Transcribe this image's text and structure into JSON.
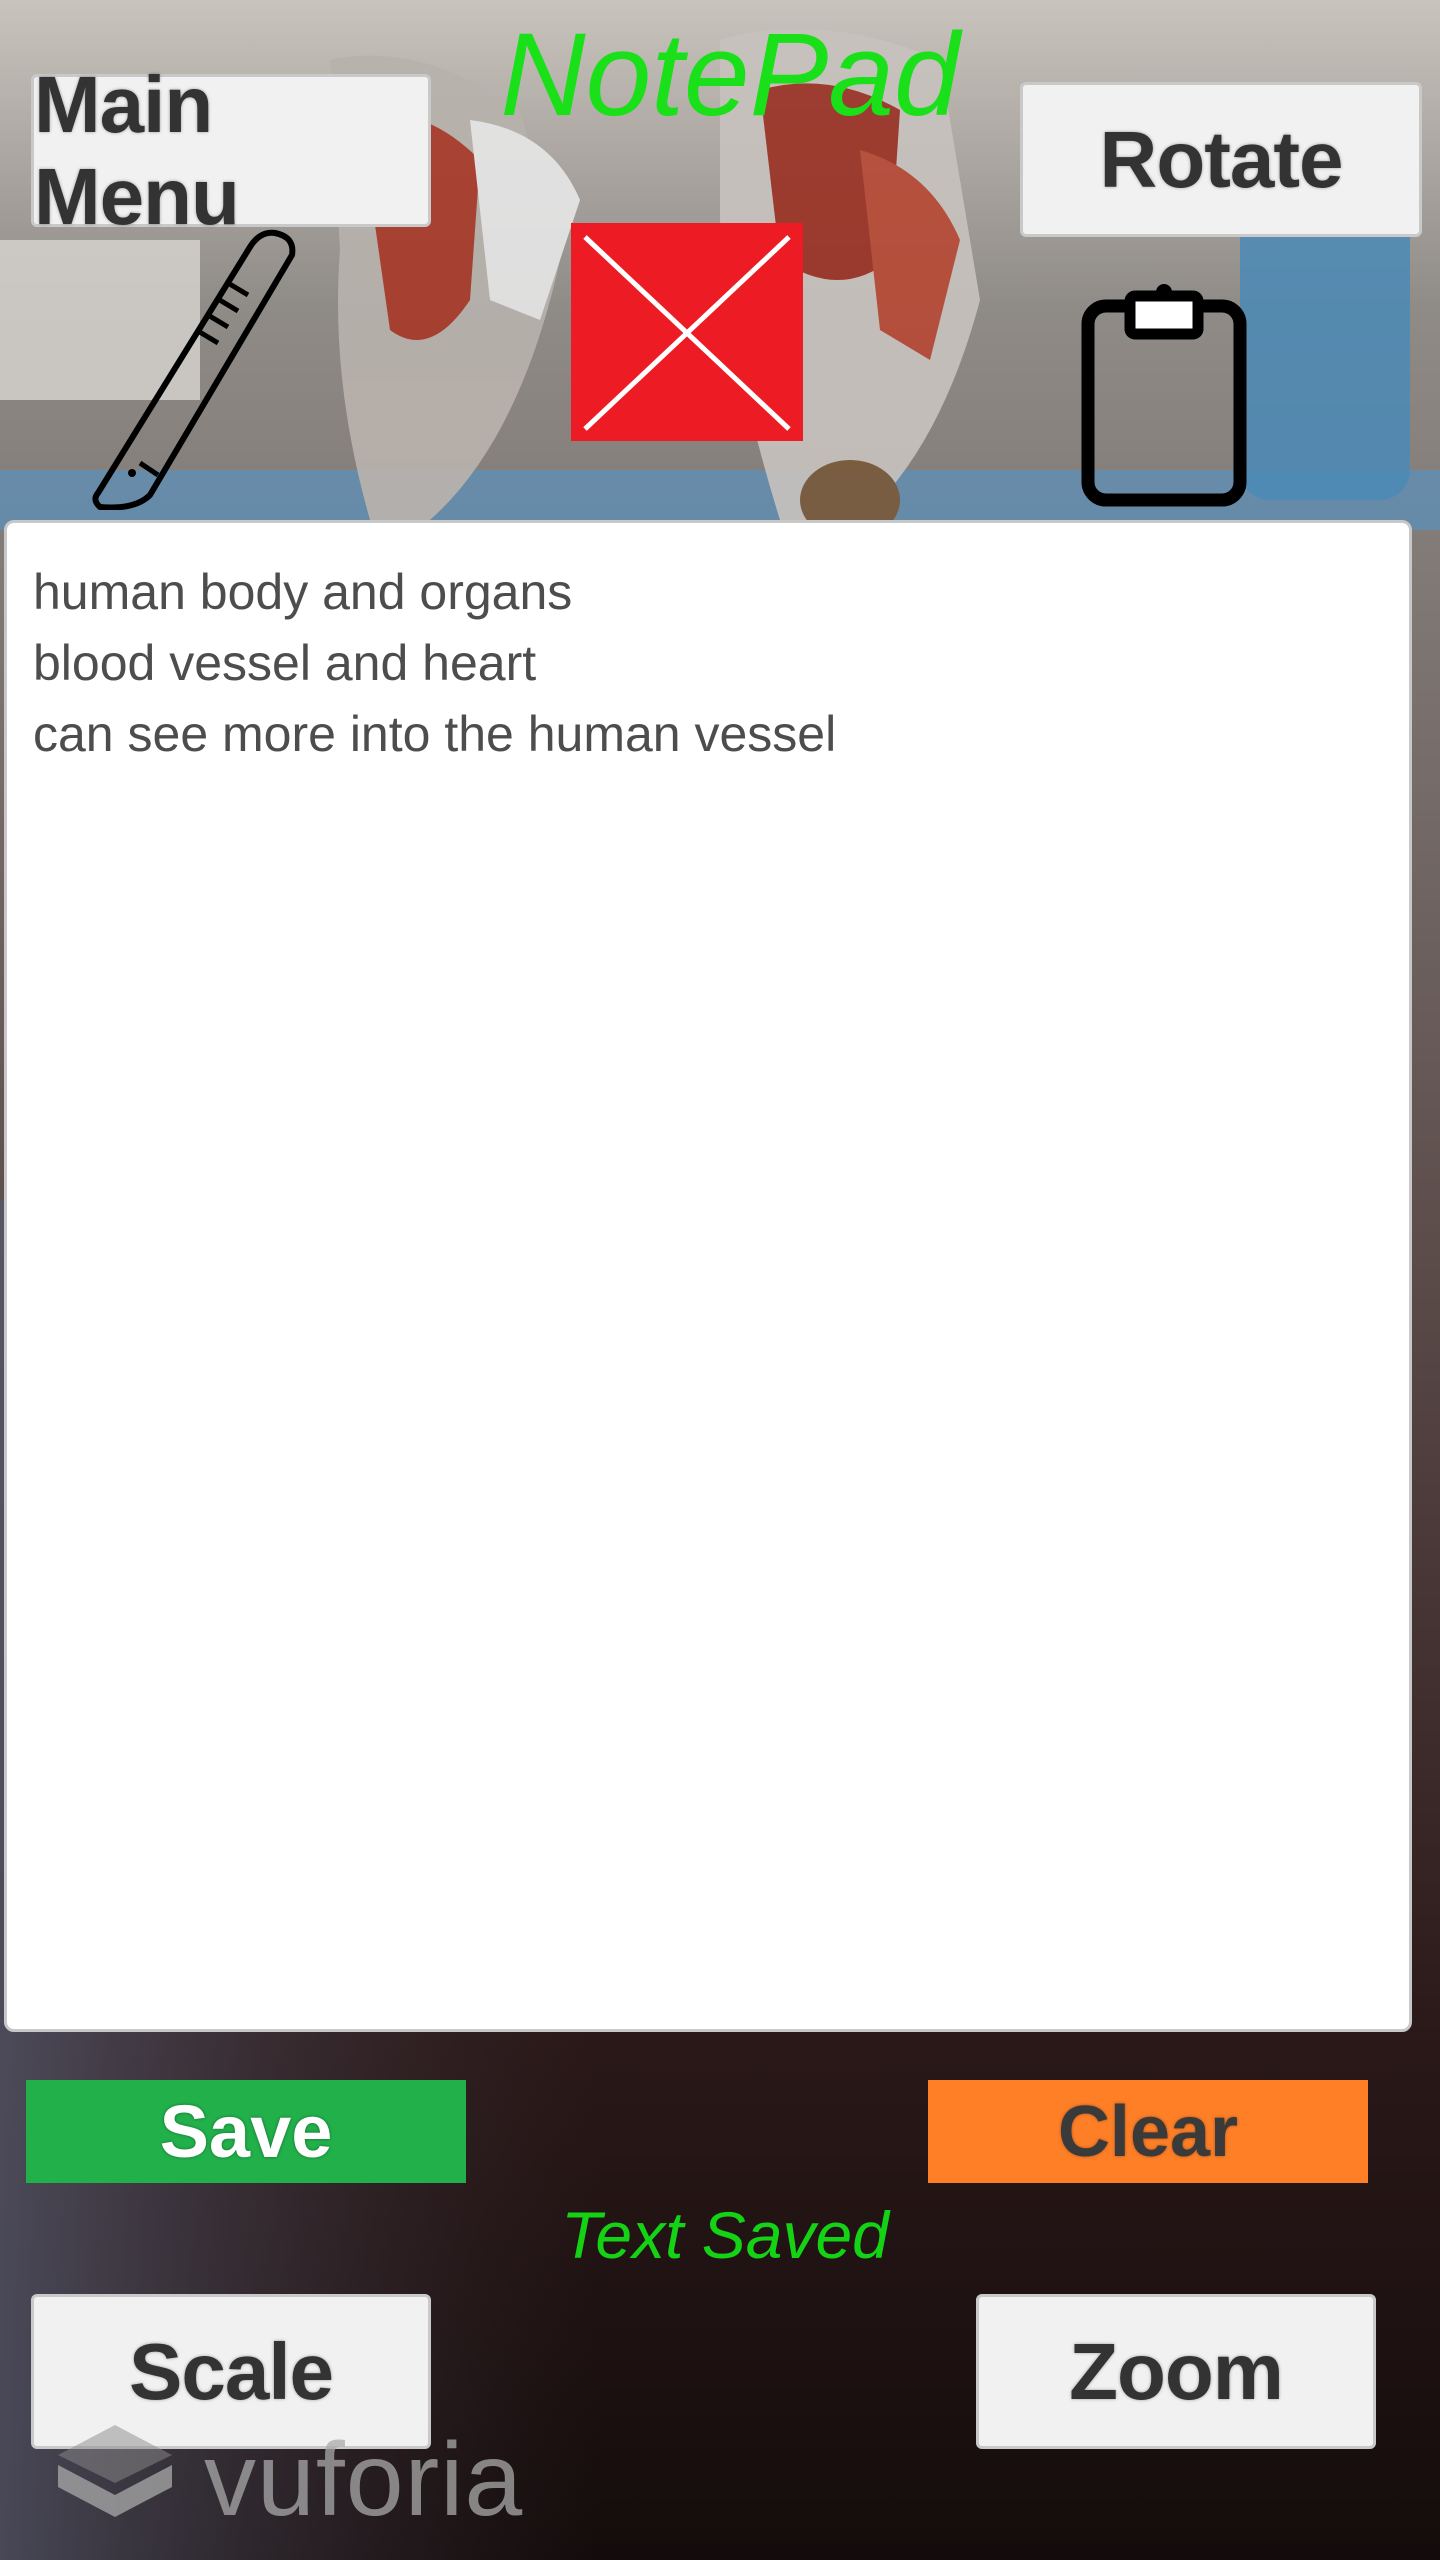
{
  "app": {
    "title": "NotePad",
    "status": "Text Saved"
  },
  "buttons": {
    "main_menu": "Main Menu",
    "rotate": "Rotate",
    "save": "Save",
    "clear": "Clear",
    "scale": "Scale",
    "zoom": "Zoom"
  },
  "notes": {
    "value": "human body and organs\nblood vessel and heart\ncan see more into the human vessel"
  },
  "icons": {
    "scalpel": "scalpel-icon",
    "close": "close-icon",
    "clipboard": "clipboard-icon"
  },
  "watermark": {
    "logo": "vuforia"
  },
  "colors": {
    "title": "#19e019",
    "status": "#14d214",
    "save": "#22b04b",
    "clear": "#ff7f27",
    "close": "#ed1c24"
  }
}
